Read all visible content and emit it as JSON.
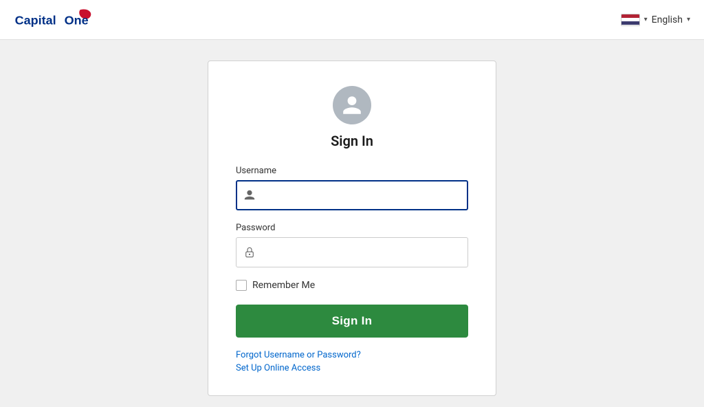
{
  "header": {
    "logo_alt": "Capital One",
    "language_label": "English",
    "flag_aria": "US Flag"
  },
  "login": {
    "title": "Sign In",
    "username_label": "Username",
    "username_placeholder": "",
    "password_label": "Password",
    "password_placeholder": "",
    "remember_me_label": "Remember Me",
    "sign_in_button": "Sign In",
    "forgot_link": "Forgot Username or Password?",
    "setup_link": "Set Up Online Access"
  }
}
